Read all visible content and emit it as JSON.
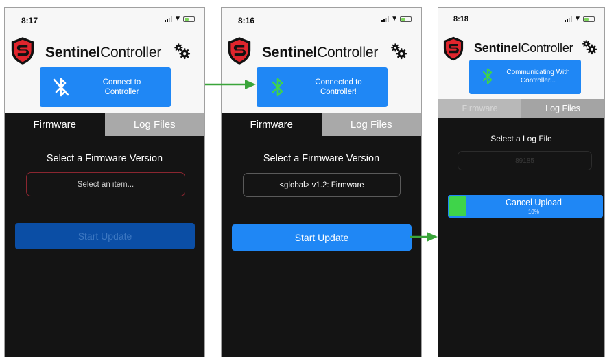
{
  "app": {
    "brand_bold": "Sentinel",
    "brand_light": "Controller"
  },
  "colors": {
    "accent": "#1f87f5",
    "progress_fill": "#3fd44a",
    "bluetooth_connected": "#3fd44a",
    "arrow": "#3aa53a"
  },
  "icons": [
    "sentinel-logo-icon",
    "gear-icon",
    "bluetooth-icon",
    "wifi-icon",
    "signal-icon",
    "battery-icon",
    "arrow-right-icon"
  ],
  "screens": [
    {
      "time": "8:17",
      "connection": {
        "line1": "Connect to",
        "line2": "Controller"
      },
      "tabs": [
        "Firmware",
        "Log Files"
      ],
      "active_tab": "Firmware",
      "select_label": "Select a Firmware Version",
      "select_value": "Select an item...",
      "action_label": "Start Update"
    },
    {
      "time": "8:16",
      "connection": {
        "line1": "Connected to",
        "line2": "Controller!"
      },
      "tabs": [
        "Firmware",
        "Log Files"
      ],
      "active_tab": "Firmware",
      "select_label": "Select a Firmware Version",
      "select_value": "<global> v1.2: Firmware",
      "action_label": "Start Update"
    },
    {
      "time": "8:18",
      "connection": {
        "line1": "Communicating With",
        "line2": "Controller..."
      },
      "tabs": [
        "Firmware",
        "Log Files"
      ],
      "active_tab": "Log Files",
      "select_label": "Select a Log File",
      "select_value": "89185",
      "upload": {
        "label": "Cancel Upload",
        "percent_text": "10%",
        "progress": 0.1
      }
    }
  ]
}
